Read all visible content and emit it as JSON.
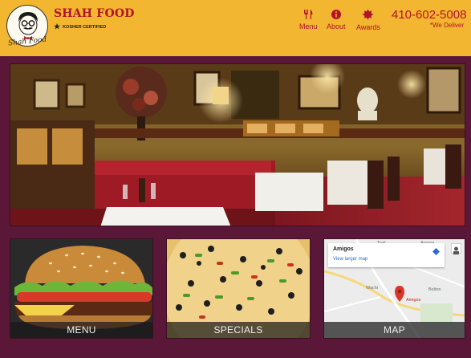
{
  "header": {
    "logo_text": "Shah Food",
    "brand": "SHAH FOOD",
    "badge": "KOSHER CERTIFIED",
    "nav": [
      {
        "label": "Menu",
        "icon": "fork-knife-icon"
      },
      {
        "label": "About",
        "icon": "info-icon"
      },
      {
        "label": "Awards",
        "icon": "award-seal-icon"
      }
    ],
    "phone": "410-602-5008",
    "tagline": "*We Deliver"
  },
  "tiles": {
    "menu": "MENU",
    "specials": "SPECIALS",
    "map": "MAP"
  },
  "map": {
    "place": "Amigos",
    "larger_link": "View larger map",
    "pin_label": "Amigos",
    "labels": [
      "Trail",
      "Ayoora",
      "Wachi",
      "Bolton"
    ]
  },
  "colors": {
    "header_bg": "#f2b630",
    "accent": "#b3122a",
    "page_bg": "#5a1738"
  }
}
